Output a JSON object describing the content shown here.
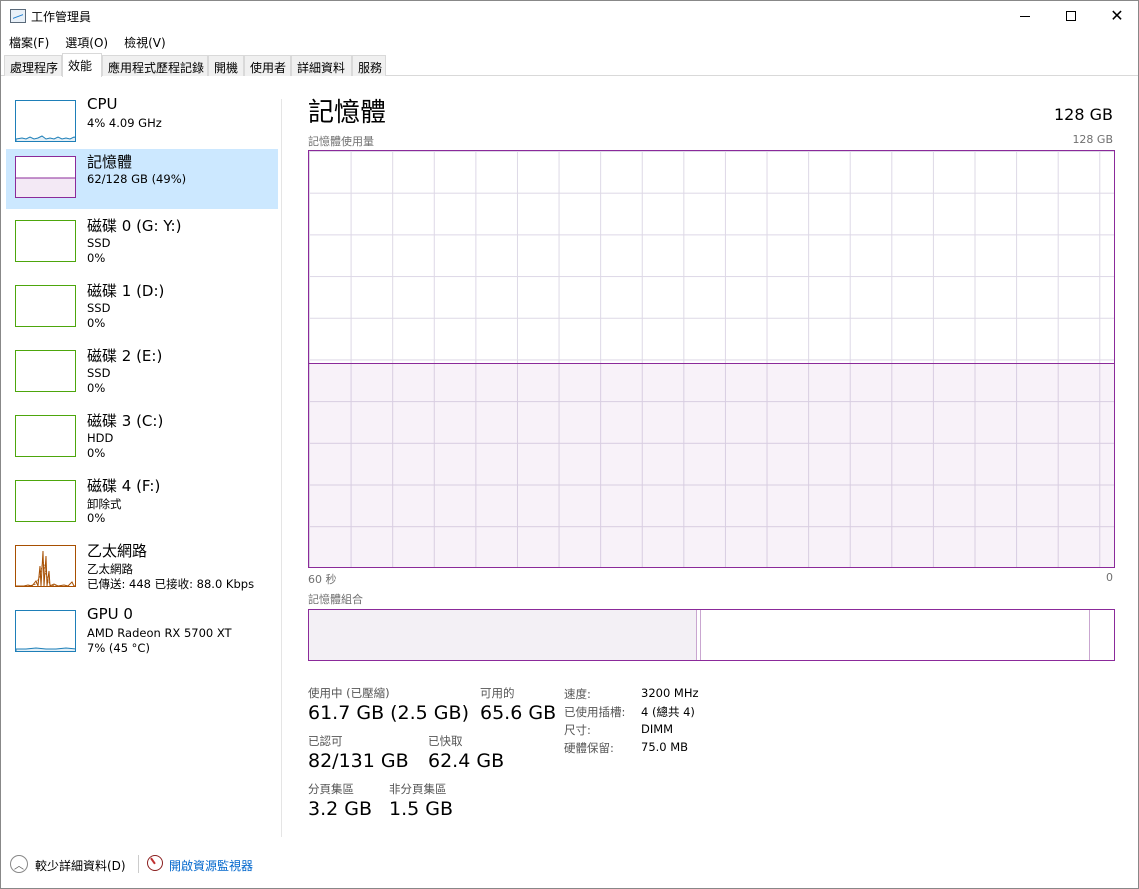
{
  "window": {
    "title": "工作管理員"
  },
  "menu": [
    "檔案(F)",
    "選項(O)",
    "檢視(V)"
  ],
  "tabs": [
    "處理程序",
    "效能",
    "應用程式歷程記錄",
    "開機",
    "使用者",
    "詳細資料",
    "服務"
  ],
  "active_tab": "效能",
  "colors": {
    "cpu": "#1e7fb8",
    "memory": "#8b2a9a",
    "disk": "#4da60c",
    "ethernet": "#a74f01",
    "gpu": "#1e7fb8",
    "selected": "#cce8ff",
    "link": "#0066cc"
  },
  "sidebar": {
    "items": [
      {
        "title": "CPU",
        "line2": "4% 4.09 GHz",
        "line3": ""
      },
      {
        "title": "記憶體",
        "line2": "62/128 GB (49%)",
        "line3": ""
      },
      {
        "title": "磁碟 0 (G: Y:)",
        "line2": "SSD",
        "line3": "0%"
      },
      {
        "title": "磁碟 1 (D:)",
        "line2": "SSD",
        "line3": "0%"
      },
      {
        "title": "磁碟 2 (E:)",
        "line2": "SSD",
        "line3": "0%"
      },
      {
        "title": "磁碟 3 (C:)",
        "line2": "HDD",
        "line3": "0%"
      },
      {
        "title": "磁碟 4 (F:)",
        "line2": "卸除式",
        "line3": "0%"
      },
      {
        "title": "乙太網路",
        "line2": "乙太網路",
        "line3": "已傳送: 448 已接收: 88.0 Kbps"
      },
      {
        "title": "GPU 0",
        "line2": "AMD Radeon RX 5700 XT",
        "line3": "7% (45 °C)"
      }
    ]
  },
  "main": {
    "title": "記憶體",
    "total": "128 GB",
    "usage_label": "記憶體使用量",
    "usage_max": "128 GB",
    "usage_fraction": 0.49,
    "time_left": "60 秒",
    "time_right": "0",
    "composition_label": "記憶體組合",
    "composition": {
      "in_use_fraction": 0.482,
      "modified_fraction": 0.005,
      "standby_fraction": 0.482
    },
    "stats": {
      "in_use_label": "使用中 (已壓縮)",
      "in_use_value": "61.7 GB (2.5 GB)",
      "available_label": "可用的",
      "available_value": "65.6 GB",
      "committed_label": "已認可",
      "committed_value": "82/131 GB",
      "cached_label": "已快取",
      "cached_value": "62.4 GB",
      "paged_label": "分頁集區",
      "paged_value": "3.2 GB",
      "nonpaged_label": "非分頁集區",
      "nonpaged_value": "1.5 GB"
    },
    "info": [
      {
        "key": "速度:",
        "value": "3200 MHz"
      },
      {
        "key": "已使用插槽:",
        "value": "4 (總共 4)"
      },
      {
        "key": "尺寸:",
        "value": "DIMM"
      },
      {
        "key": "硬體保留:",
        "value": "75.0 MB"
      }
    ]
  },
  "footer": {
    "fewer_details": "較少詳細資料(D)",
    "resource_monitor": "開啟資源監視器"
  }
}
